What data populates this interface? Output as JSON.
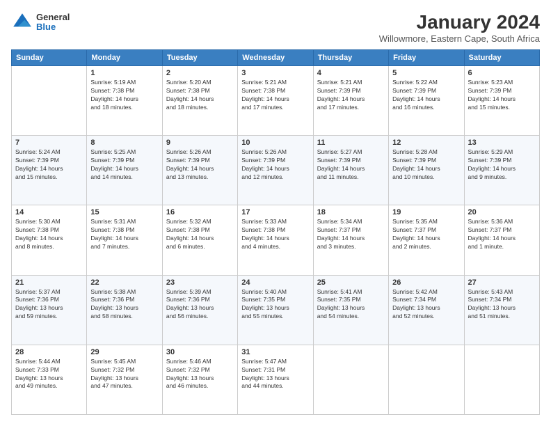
{
  "logo": {
    "general": "General",
    "blue": "Blue"
  },
  "title": {
    "main": "January 2024",
    "sub": "Willowmore, Eastern Cape, South Africa"
  },
  "days_of_week": [
    "Sunday",
    "Monday",
    "Tuesday",
    "Wednesday",
    "Thursday",
    "Friday",
    "Saturday"
  ],
  "weeks": [
    [
      {
        "day": "",
        "info": ""
      },
      {
        "day": "1",
        "info": "Sunrise: 5:19 AM\nSunset: 7:38 PM\nDaylight: 14 hours\nand 18 minutes."
      },
      {
        "day": "2",
        "info": "Sunrise: 5:20 AM\nSunset: 7:38 PM\nDaylight: 14 hours\nand 18 minutes."
      },
      {
        "day": "3",
        "info": "Sunrise: 5:21 AM\nSunset: 7:38 PM\nDaylight: 14 hours\nand 17 minutes."
      },
      {
        "day": "4",
        "info": "Sunrise: 5:21 AM\nSunset: 7:39 PM\nDaylight: 14 hours\nand 17 minutes."
      },
      {
        "day": "5",
        "info": "Sunrise: 5:22 AM\nSunset: 7:39 PM\nDaylight: 14 hours\nand 16 minutes."
      },
      {
        "day": "6",
        "info": "Sunrise: 5:23 AM\nSunset: 7:39 PM\nDaylight: 14 hours\nand 15 minutes."
      }
    ],
    [
      {
        "day": "7",
        "info": "Sunrise: 5:24 AM\nSunset: 7:39 PM\nDaylight: 14 hours\nand 15 minutes."
      },
      {
        "day": "8",
        "info": "Sunrise: 5:25 AM\nSunset: 7:39 PM\nDaylight: 14 hours\nand 14 minutes."
      },
      {
        "day": "9",
        "info": "Sunrise: 5:26 AM\nSunset: 7:39 PM\nDaylight: 14 hours\nand 13 minutes."
      },
      {
        "day": "10",
        "info": "Sunrise: 5:26 AM\nSunset: 7:39 PM\nDaylight: 14 hours\nand 12 minutes."
      },
      {
        "day": "11",
        "info": "Sunrise: 5:27 AM\nSunset: 7:39 PM\nDaylight: 14 hours\nand 11 minutes."
      },
      {
        "day": "12",
        "info": "Sunrise: 5:28 AM\nSunset: 7:39 PM\nDaylight: 14 hours\nand 10 minutes."
      },
      {
        "day": "13",
        "info": "Sunrise: 5:29 AM\nSunset: 7:39 PM\nDaylight: 14 hours\nand 9 minutes."
      }
    ],
    [
      {
        "day": "14",
        "info": "Sunrise: 5:30 AM\nSunset: 7:38 PM\nDaylight: 14 hours\nand 8 minutes."
      },
      {
        "day": "15",
        "info": "Sunrise: 5:31 AM\nSunset: 7:38 PM\nDaylight: 14 hours\nand 7 minutes."
      },
      {
        "day": "16",
        "info": "Sunrise: 5:32 AM\nSunset: 7:38 PM\nDaylight: 14 hours\nand 6 minutes."
      },
      {
        "day": "17",
        "info": "Sunrise: 5:33 AM\nSunset: 7:38 PM\nDaylight: 14 hours\nand 4 minutes."
      },
      {
        "day": "18",
        "info": "Sunrise: 5:34 AM\nSunset: 7:37 PM\nDaylight: 14 hours\nand 3 minutes."
      },
      {
        "day": "19",
        "info": "Sunrise: 5:35 AM\nSunset: 7:37 PM\nDaylight: 14 hours\nand 2 minutes."
      },
      {
        "day": "20",
        "info": "Sunrise: 5:36 AM\nSunset: 7:37 PM\nDaylight: 14 hours\nand 1 minute."
      }
    ],
    [
      {
        "day": "21",
        "info": "Sunrise: 5:37 AM\nSunset: 7:36 PM\nDaylight: 13 hours\nand 59 minutes."
      },
      {
        "day": "22",
        "info": "Sunrise: 5:38 AM\nSunset: 7:36 PM\nDaylight: 13 hours\nand 58 minutes."
      },
      {
        "day": "23",
        "info": "Sunrise: 5:39 AM\nSunset: 7:36 PM\nDaylight: 13 hours\nand 56 minutes."
      },
      {
        "day": "24",
        "info": "Sunrise: 5:40 AM\nSunset: 7:35 PM\nDaylight: 13 hours\nand 55 minutes."
      },
      {
        "day": "25",
        "info": "Sunrise: 5:41 AM\nSunset: 7:35 PM\nDaylight: 13 hours\nand 54 minutes."
      },
      {
        "day": "26",
        "info": "Sunrise: 5:42 AM\nSunset: 7:34 PM\nDaylight: 13 hours\nand 52 minutes."
      },
      {
        "day": "27",
        "info": "Sunrise: 5:43 AM\nSunset: 7:34 PM\nDaylight: 13 hours\nand 51 minutes."
      }
    ],
    [
      {
        "day": "28",
        "info": "Sunrise: 5:44 AM\nSunset: 7:33 PM\nDaylight: 13 hours\nand 49 minutes."
      },
      {
        "day": "29",
        "info": "Sunrise: 5:45 AM\nSunset: 7:32 PM\nDaylight: 13 hours\nand 47 minutes."
      },
      {
        "day": "30",
        "info": "Sunrise: 5:46 AM\nSunset: 7:32 PM\nDaylight: 13 hours\nand 46 minutes."
      },
      {
        "day": "31",
        "info": "Sunrise: 5:47 AM\nSunset: 7:31 PM\nDaylight: 13 hours\nand 44 minutes."
      },
      {
        "day": "",
        "info": ""
      },
      {
        "day": "",
        "info": ""
      },
      {
        "day": "",
        "info": ""
      }
    ]
  ]
}
